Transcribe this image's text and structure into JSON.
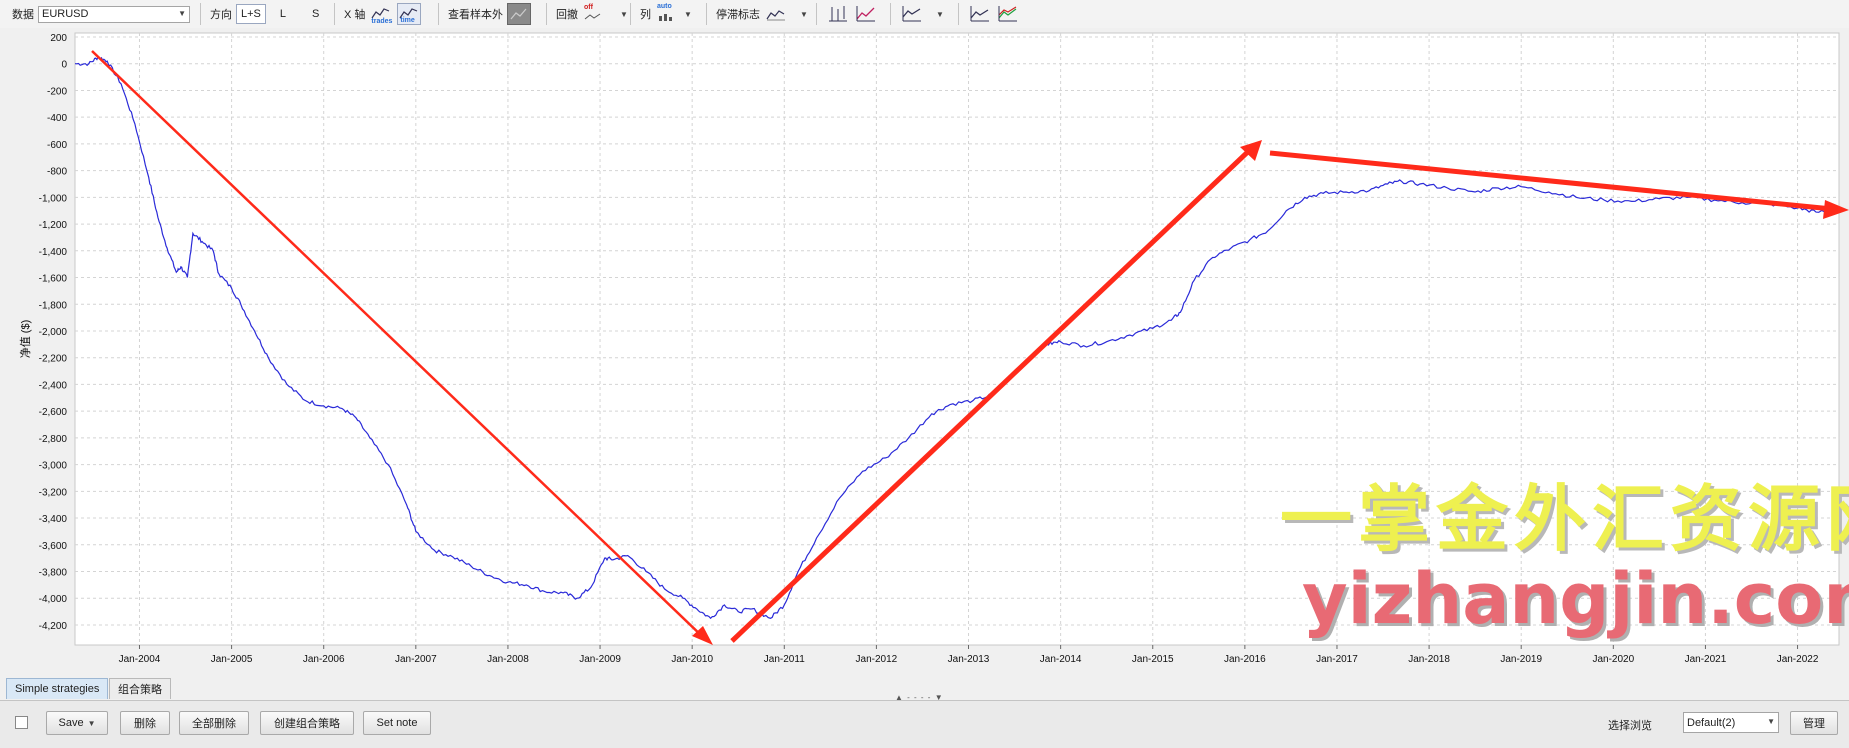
{
  "toolbar": {
    "data_label": "数据",
    "data_value": "EURUSD",
    "direction_label": "方向",
    "direction_options": [
      "L+S",
      "L",
      "S"
    ],
    "xaxis_label": "X 轴",
    "xaxis_trades": "trades",
    "xaxis_time": "time",
    "outsample_label": "查看样本外",
    "drawdown_label": "回撤",
    "drawdown_state": "off",
    "columns_label": "列",
    "columns_state": "auto",
    "smooth_label": "停滞标志"
  },
  "chart_data": {
    "type": "line",
    "ylabel": "净值 ($)",
    "xlabel": "",
    "ylim": [
      -4350,
      230
    ],
    "yticks": [
      200,
      0,
      -200,
      -400,
      -600,
      -800,
      -1000,
      -1200,
      -1400,
      -1600,
      -1800,
      -2000,
      -2200,
      -2400,
      -2600,
      -2800,
      -3000,
      -3200,
      -3400,
      -3600,
      -3800,
      -4000,
      -4200
    ],
    "xlim": [
      2003.3,
      2022.45
    ],
    "xticks": [
      {
        "label": "Jan-2004",
        "x": 2004
      },
      {
        "label": "Jan-2005",
        "x": 2005
      },
      {
        "label": "Jan-2006",
        "x": 2006
      },
      {
        "label": "Jan-2007",
        "x": 2007
      },
      {
        "label": "Jan-2008",
        "x": 2008
      },
      {
        "label": "Jan-2009",
        "x": 2009
      },
      {
        "label": "Jan-2010",
        "x": 2010
      },
      {
        "label": "Jan-2011",
        "x": 2011
      },
      {
        "label": "Jan-2012",
        "x": 2012
      },
      {
        "label": "Jan-2013",
        "x": 2013
      },
      {
        "label": "Jan-2014",
        "x": 2014
      },
      {
        "label": "Jan-2015",
        "x": 2015
      },
      {
        "label": "Jan-2016",
        "x": 2016
      },
      {
        "label": "Jan-2017",
        "x": 2017
      },
      {
        "label": "Jan-2018",
        "x": 2018
      },
      {
        "label": "Jan-2019",
        "x": 2019
      },
      {
        "label": "Jan-2020",
        "x": 2020
      },
      {
        "label": "Jan-2021",
        "x": 2021
      },
      {
        "label": "Jan-2022",
        "x": 2022
      }
    ],
    "grid": true,
    "series": [
      {
        "color": "#2a2ad8",
        "points": [
          [
            2003.3,
            0
          ],
          [
            2003.45,
            0
          ],
          [
            2003.55,
            50
          ],
          [
            2003.65,
            20
          ],
          [
            2003.8,
            -150
          ],
          [
            2003.95,
            -450
          ],
          [
            2004.1,
            -850
          ],
          [
            2004.2,
            -1150
          ],
          [
            2004.3,
            -1380
          ],
          [
            2004.4,
            -1560
          ],
          [
            2004.45,
            -1520
          ],
          [
            2004.52,
            -1600
          ],
          [
            2004.58,
            -1270
          ],
          [
            2004.68,
            -1330
          ],
          [
            2004.8,
            -1400
          ],
          [
            2004.86,
            -1570
          ],
          [
            2005.0,
            -1680
          ],
          [
            2005.1,
            -1800
          ],
          [
            2005.25,
            -2000
          ],
          [
            2005.4,
            -2200
          ],
          [
            2005.6,
            -2400
          ],
          [
            2005.8,
            -2520
          ],
          [
            2006.0,
            -2560
          ],
          [
            2006.2,
            -2580
          ],
          [
            2006.35,
            -2650
          ],
          [
            2006.5,
            -2800
          ],
          [
            2006.7,
            -3000
          ],
          [
            2006.9,
            -3300
          ],
          [
            2007.0,
            -3500
          ],
          [
            2007.2,
            -3640
          ],
          [
            2007.4,
            -3690
          ],
          [
            2007.6,
            -3760
          ],
          [
            2007.8,
            -3830
          ],
          [
            2008.0,
            -3880
          ],
          [
            2008.2,
            -3900
          ],
          [
            2008.4,
            -3950
          ],
          [
            2008.6,
            -3960
          ],
          [
            2008.75,
            -4000
          ],
          [
            2008.9,
            -3920
          ],
          [
            2009.05,
            -3700
          ],
          [
            2009.15,
            -3710
          ],
          [
            2009.3,
            -3680
          ],
          [
            2009.5,
            -3800
          ],
          [
            2009.7,
            -3930
          ],
          [
            2009.9,
            -4000
          ],
          [
            2010.05,
            -4080
          ],
          [
            2010.2,
            -4150
          ],
          [
            2010.35,
            -4050
          ],
          [
            2010.5,
            -4100
          ],
          [
            2010.65,
            -4080
          ],
          [
            2010.85,
            -4150
          ],
          [
            2011.0,
            -4050
          ],
          [
            2011.15,
            -3800
          ],
          [
            2011.35,
            -3550
          ],
          [
            2011.6,
            -3250
          ],
          [
            2011.85,
            -3050
          ],
          [
            2012.1,
            -2950
          ],
          [
            2012.35,
            -2800
          ],
          [
            2012.6,
            -2620
          ],
          [
            2012.8,
            -2550
          ],
          [
            2013.05,
            -2520
          ],
          [
            2013.25,
            -2480
          ],
          [
            2013.45,
            -2350
          ],
          [
            2013.65,
            -2200
          ],
          [
            2013.85,
            -2100
          ],
          [
            2014.0,
            -2080
          ],
          [
            2014.25,
            -2110
          ],
          [
            2014.5,
            -2080
          ],
          [
            2014.75,
            -2030
          ],
          [
            2015.0,
            -1980
          ],
          [
            2015.2,
            -1920
          ],
          [
            2015.3,
            -1860
          ],
          [
            2015.45,
            -1620
          ],
          [
            2015.65,
            -1450
          ],
          [
            2015.85,
            -1380
          ],
          [
            2016.05,
            -1320
          ],
          [
            2016.25,
            -1250
          ],
          [
            2016.45,
            -1100
          ],
          [
            2016.65,
            -1000
          ],
          [
            2016.85,
            -970
          ],
          [
            2017.1,
            -960
          ],
          [
            2017.35,
            -950
          ],
          [
            2017.55,
            -900
          ],
          [
            2017.7,
            -880
          ],
          [
            2017.9,
            -900
          ],
          [
            2018.2,
            -930
          ],
          [
            2018.5,
            -960
          ],
          [
            2018.75,
            -930
          ],
          [
            2019.0,
            -920
          ],
          [
            2019.3,
            -960
          ],
          [
            2019.6,
            -1000
          ],
          [
            2019.9,
            -1020
          ],
          [
            2020.2,
            -1030
          ],
          [
            2020.5,
            -1010
          ],
          [
            2020.8,
            -1000
          ],
          [
            2021.1,
            -1020
          ],
          [
            2021.4,
            -1040
          ],
          [
            2021.7,
            -1050
          ],
          [
            2022.0,
            -1080
          ],
          [
            2022.2,
            -1110
          ],
          [
            2022.45,
            -1100
          ]
        ]
      }
    ]
  },
  "watermark": {
    "cn": "一掌金外汇资源网",
    "en": "yizhangjin.com"
  },
  "tabs": [
    {
      "label": "Simple strategies",
      "active": true
    },
    {
      "label": "组合策略",
      "active": false
    }
  ],
  "bottom": {
    "save_label": "Save",
    "delete_label": "删除",
    "delete_all_label": "全部删除",
    "create_combo_label": "创建组合策略",
    "set_note_label": "Set note",
    "view_label": "选择浏览",
    "view_value": "Default(2)",
    "manage_label": "管理"
  },
  "colors": {
    "series": "#2a2ad8",
    "annotation_arrows": "#ff2a1a",
    "grid": "#d4d4d4"
  }
}
